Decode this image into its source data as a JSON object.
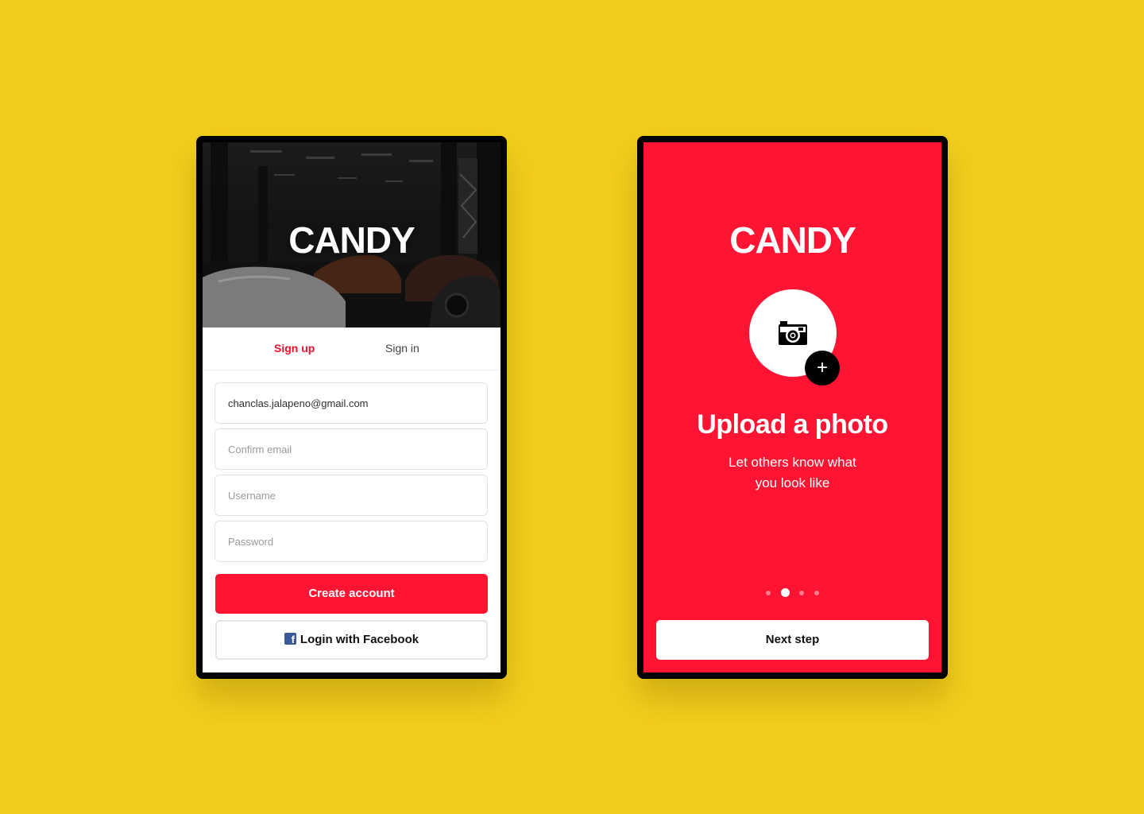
{
  "colors": {
    "background": "#F2CE1C",
    "brand_red": "#FF1433",
    "tab_active": "#E8112D",
    "facebook_blue": "#3B5998"
  },
  "signup_screen": {
    "logo": "CANDY",
    "hero_image": "dark car showroom photo",
    "tabs": [
      {
        "label": "Sign up",
        "active": true
      },
      {
        "label": "Sign in",
        "active": false
      }
    ],
    "fields": {
      "email": {
        "value": "chanclas.jalapeno@gmail.com",
        "placeholder": ""
      },
      "confirm_email": {
        "value": "",
        "placeholder": "Confirm email"
      },
      "username": {
        "value": "",
        "placeholder": "Username"
      },
      "password": {
        "value": "",
        "placeholder": "Password"
      }
    },
    "create_account_label": "Create account",
    "facebook_label": "Login with Facebook",
    "facebook_icon": "facebook-icon"
  },
  "onboarding_screen": {
    "logo": "CANDY",
    "avatar_icon": "camera-icon",
    "add_icon": "plus-icon",
    "add_symbol": "+",
    "headline": "Upload a photo",
    "subtitle_lines": [
      "Let others know what",
      "you look like"
    ],
    "pagination": {
      "total": 4,
      "active_index": 1
    },
    "next_label": "Next step"
  }
}
